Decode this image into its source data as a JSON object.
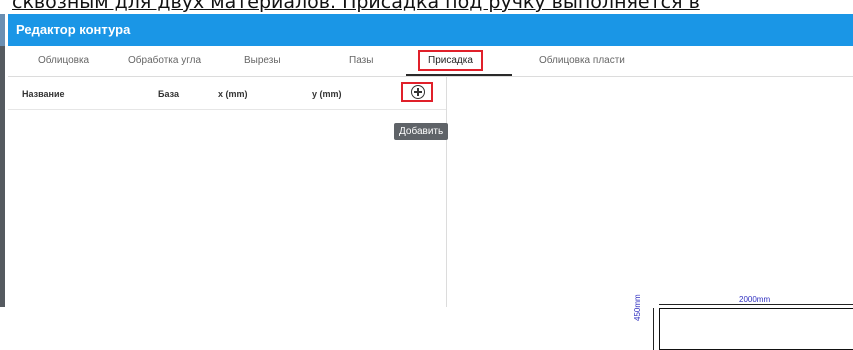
{
  "doc_caption": "сквозным для двух материалов. Присадка под ручку выполняется в",
  "window": {
    "title": "Редактор контура"
  },
  "tabs": [
    {
      "label": "Облицовка"
    },
    {
      "label": "Обработка угла"
    },
    {
      "label": "Вырезы"
    },
    {
      "label": "Пазы"
    },
    {
      "label": "Присадка",
      "active": true
    },
    {
      "label": "Облицовка пласти"
    }
  ],
  "table": {
    "columns": [
      "Название",
      "База",
      "x (mm)",
      "y (mm)"
    ],
    "add_icon": "plus-circle-icon",
    "add_tooltip": "Добавить"
  },
  "preview": {
    "width_label": "2000mm",
    "height_label": "450mm"
  },
  "colors": {
    "titlebar": "#1a96e6",
    "highlight": "#e0202a",
    "dimension_text": "#3030c0"
  }
}
